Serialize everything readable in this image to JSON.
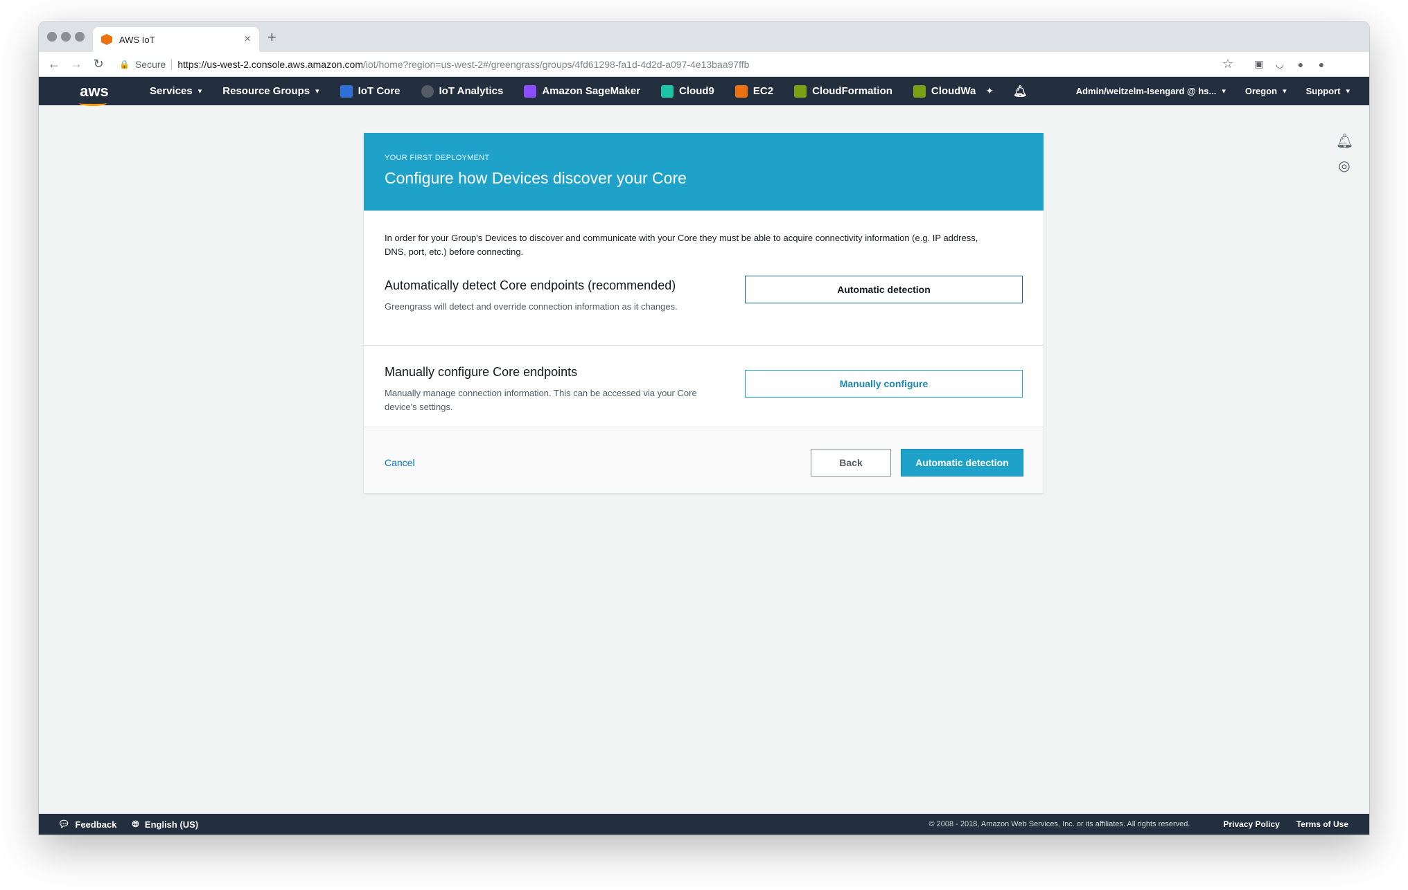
{
  "browser": {
    "tab_title": "AWS IoT",
    "new_tab": "+",
    "close": "×",
    "secure_label": "Secure",
    "url_host": "https://us-west-2.console.aws.amazon.com",
    "url_path": "/iot/home?region=us-west-2#/greengrass/groups/4fd61298-fa1d-4d2d-a097-4e13baa97ffb"
  },
  "awsnav": {
    "logo": "aws",
    "services": "Services",
    "resource_groups": "Resource Groups",
    "shortcuts": [
      {
        "label": "IoT Core",
        "color": "#2e6fd8"
      },
      {
        "label": "IoT Analytics",
        "color": "#545b64"
      },
      {
        "label": "Amazon SageMaker",
        "color": "#8c4fff"
      },
      {
        "label": "Cloud9",
        "color": "#1ec4a5"
      },
      {
        "label": "EC2",
        "color": "#ec7211"
      },
      {
        "label": "CloudFormation",
        "color": "#7aa116"
      },
      {
        "label": "CloudWa",
        "color": "#7aa116"
      }
    ],
    "account": "Admin/weitzelm-Isengard @ hs...",
    "region": "Oregon",
    "support": "Support"
  },
  "card": {
    "eyebrow": "YOUR FIRST DEPLOYMENT",
    "title": "Configure how Devices discover your Core",
    "intro": "In order for your Group's Devices to discover and communicate with your Core they must be able to acquire connectivity information (e.g. IP address, DNS, port, etc.) before connecting.",
    "auto": {
      "title": "Automatically detect Core endpoints (recommended)",
      "desc": "Greengrass will detect and override connection information as it changes.",
      "button": "Automatic detection"
    },
    "manual": {
      "title": "Manually configure Core endpoints",
      "desc": "Manually manage connection information. This can be accessed via your Core device's settings.",
      "button": "Manually configure"
    },
    "footer": {
      "cancel": "Cancel",
      "back": "Back",
      "primary": "Automatic detection"
    }
  },
  "bottombar": {
    "feedback": "Feedback",
    "language": "English (US)",
    "copyright": "© 2008 - 2018, Amazon Web Services, Inc. or its affiliates. All rights reserved.",
    "privacy": "Privacy Policy",
    "terms": "Terms of Use"
  }
}
